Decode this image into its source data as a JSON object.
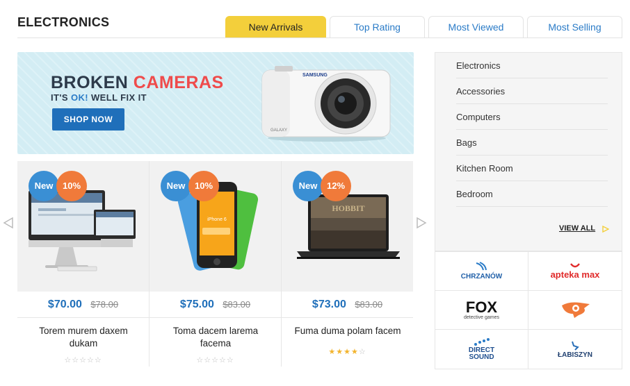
{
  "section": {
    "title": "ELECTRONICS"
  },
  "tabs": [
    {
      "label": "New Arrivals"
    },
    {
      "label": "Top Rating"
    },
    {
      "label": "Most Viewed"
    },
    {
      "label": "Most Selling"
    }
  ],
  "banner": {
    "headline_1": "BROKEN",
    "headline_2": "CAMERAS",
    "tag_1": "IT'S",
    "tag_ok": "OK!",
    "tag_2": "WELL FIX IT",
    "button": "SHOP NOW",
    "camera_brand": "SAMSUNG",
    "camera_model": "GALAXY"
  },
  "products": [
    {
      "badge_new": "New",
      "badge_off": "10%",
      "price": "$70.00",
      "old_price": "$78.00",
      "name": "Torem murem daxem dukam",
      "rating": 0
    },
    {
      "badge_new": "New",
      "badge_off": "10%",
      "price": "$75.00",
      "old_price": "$83.00",
      "name": "Toma dacem larema facema",
      "rating": 0,
      "screen_text": "iPhone 6"
    },
    {
      "badge_new": "New",
      "badge_off": "12%",
      "price": "$73.00",
      "old_price": "$83.00",
      "name": "Fuma duma polam facem",
      "rating": 4,
      "screen_text": "HOBBIT"
    }
  ],
  "categories": [
    {
      "label": "Electronics"
    },
    {
      "label": "Accessories"
    },
    {
      "label": "Computers"
    },
    {
      "label": "Bags"
    },
    {
      "label": "Kitchen Room"
    },
    {
      "label": "Bedroom"
    }
  ],
  "view_all": "VIEW ALL",
  "brands": [
    {
      "name": "CHRZANÓW",
      "color": "#1f5fa8"
    },
    {
      "name": "apteka max",
      "color": "#e02a2a"
    },
    {
      "name": "FOX",
      "sub": "detective games",
      "color": "#111111"
    },
    {
      "name": "",
      "color": "#f07a3a"
    },
    {
      "name": "DIRECT SOUND",
      "color": "#1f4f8f"
    },
    {
      "name": "ŁABISZYN",
      "color": "#1f3f6f"
    }
  ],
  "colors": {
    "accent_yellow": "#f3cf3b",
    "link_blue": "#2a7bc7",
    "badge_blue": "#3a8fd4",
    "badge_orange": "#f07a3a",
    "banner_red": "#ef4b4b"
  }
}
